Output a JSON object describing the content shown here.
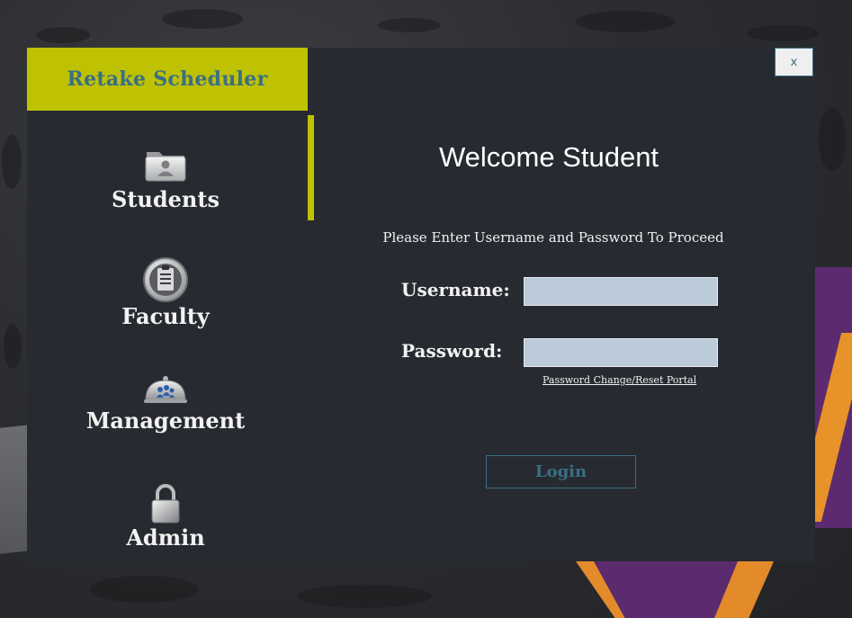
{
  "app": {
    "title": "Retake Scheduler",
    "close_label": "x"
  },
  "sidebar": {
    "items": [
      {
        "label": "Students",
        "icon": "student-folder-icon"
      },
      {
        "label": "Faculty",
        "icon": "clipboard-icon"
      },
      {
        "label": "Management",
        "icon": "management-dome-icon"
      },
      {
        "label": "Admin",
        "icon": "padlock-icon"
      }
    ],
    "active_index": 0
  },
  "login": {
    "heading": "Welcome Student",
    "instruction": "Please Enter Username and Password To Proceed",
    "username_label": "Username:",
    "username_value": "",
    "password_label": "Password:",
    "password_value": "",
    "reset_link": "Password Change/Reset Portal",
    "login_button": "Login"
  },
  "colors": {
    "accent": "#bfc103",
    "window_bg": "#272a31",
    "brand_text": "#3a6f86",
    "input_bg": "#bccbda"
  }
}
